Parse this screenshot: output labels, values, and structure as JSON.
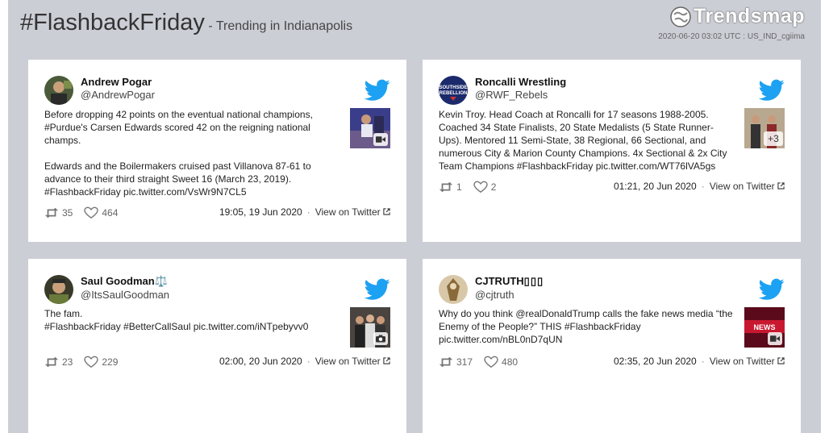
{
  "header": {
    "hashtag": "#FlashbackFriday",
    "subtitle": "- Trending in Indianapolis",
    "logo": "Trendsmap",
    "timestamp": "2020-06-20 03:02 UTC : US_IND_cgiima"
  },
  "colors": {
    "twitter_blue": "#1da1f2",
    "background": "#ccced6"
  },
  "tweets": [
    {
      "name": "Andrew Pogar",
      "handle": "@AndrewPogar",
      "text": "Before dropping 42 points on the eventual national champions, #Purdue's Carsen Edwards scored 42 on the reigning national champs.\n\nEdwards and the Boilermakers cruised past Villanova 87-61 to advance to their third straight Sweet 16 (March 23, 2019). #FlashbackFriday pic.twitter.com/VsWr9N7CL5",
      "retweets": "35",
      "likes": "464",
      "time": "19:05, 19 Jun 2020",
      "view": "View on Twitter",
      "media": "video-icon"
    },
    {
      "name": "Roncalli Wrestling",
      "handle": "@RWF_Rebels",
      "text": "Kevin Troy. Head Coach at Roncalli for 17 seasons 1988-2005. Coached 34 State Finalists, 20 State Medalists (5 State Runner-Ups). Mentored 11 Semi-State, 38 Regional, 66 Sectional, and numerous City & Marion County Champions. 4x Sectional & 2x City Team Champions #FlashbackFriday pic.twitter.com/WT76lVA5gs",
      "retweets": "1",
      "likes": "2",
      "time": "01:21, 20 Jun 2020",
      "view": "View on Twitter",
      "media_count": "+3"
    },
    {
      "name": "Saul Goodman⚖️",
      "handle": "@ItsSaulGoodman",
      "text": "The fam.\n#FlashbackFriday #BetterCallSaul pic.twitter.com/iNTpebyvv0",
      "retweets": "23",
      "likes": "229",
      "time": "02:00, 20 Jun 2020",
      "view": "View on Twitter",
      "media": "camera-icon"
    },
    {
      "name": "CJTRUTH",
      "handle": "@cjtruth",
      "text": "Why do you think @realDonaldTrump calls the fake news media “the Enemy of the People?” THIS #FlashbackFriday pic.twitter.com/nBL0nD7qUN",
      "retweets": "317",
      "likes": "480",
      "time": "02:35, 20 Jun 2020",
      "view": "View on Twitter",
      "media": "video-icon"
    }
  ]
}
